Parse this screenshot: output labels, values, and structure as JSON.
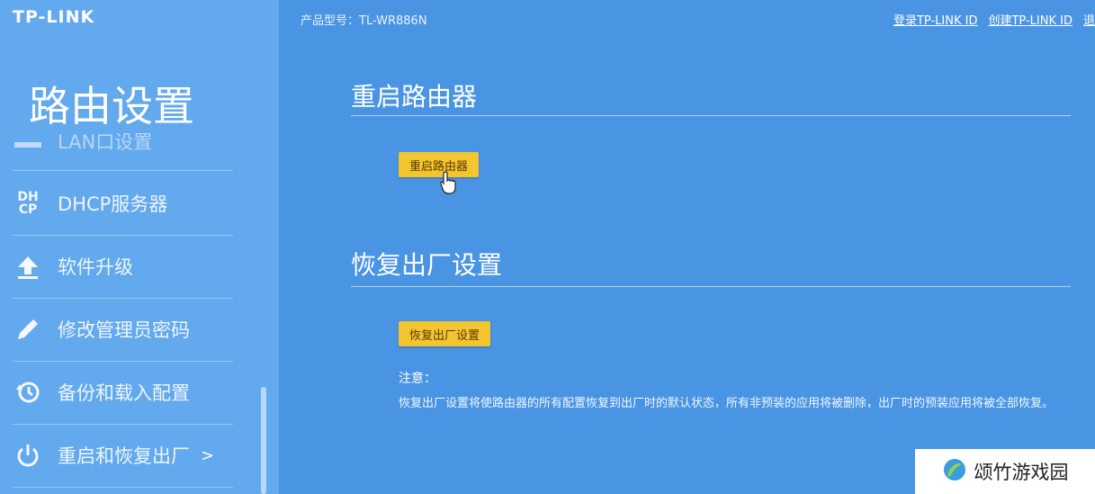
{
  "brand": {
    "logo": "TP-LINK"
  },
  "header": {
    "model": "产品型号：TL-WR886N",
    "links": [
      "登录TP-LINK ID",
      "创建TP-LINK ID",
      "退"
    ]
  },
  "sidebar": {
    "title": "路由设置",
    "items": [
      {
        "label": "LAN口设置",
        "icon": "lan-icon"
      },
      {
        "label": "DHCP服务器",
        "icon": "dhcp-icon"
      },
      {
        "label": "软件升级",
        "icon": "upload-icon"
      },
      {
        "label": "修改管理员密码",
        "icon": "pencil-icon"
      },
      {
        "label": "备份和载入配置",
        "icon": "history-icon"
      },
      {
        "label": "重启和恢复出厂",
        "icon": "power-icon",
        "arrow": ">"
      }
    ]
  },
  "main": {
    "reboot": {
      "title": "重启路由器",
      "button": "重启路由器"
    },
    "reset": {
      "title": "恢复出厂设置",
      "button": "恢复出厂设置",
      "note_title": "注意：",
      "note_text": "恢复出厂设置将使路由器的所有配置恢复到出厂时的默认状态，所有非预装的应用将被删除，出厂时的预装应用将被全部恢复。"
    }
  },
  "watermark": {
    "text": "颂竹游戏园"
  },
  "colors": {
    "background": "#4a95e3",
    "sidebar": "#63a9ee",
    "button": "#f3c531"
  }
}
